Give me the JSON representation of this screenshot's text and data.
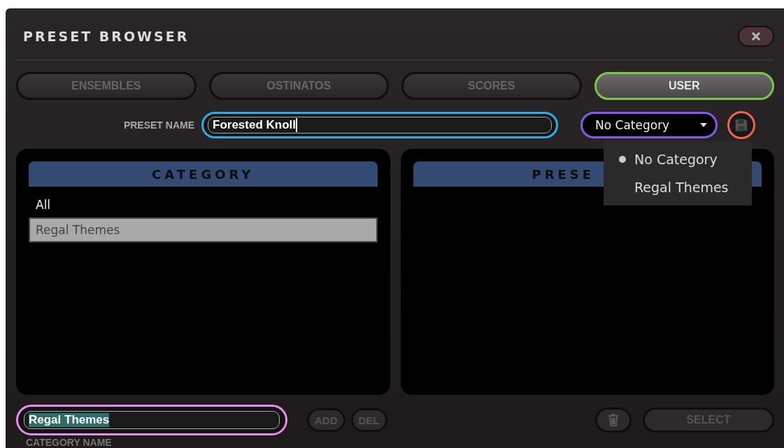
{
  "window": {
    "title": "PRESET BROWSER"
  },
  "tabs": [
    {
      "label": "ENSEMBLES",
      "selected": false
    },
    {
      "label": "OSTINATOS",
      "selected": false
    },
    {
      "label": "SCORES",
      "selected": false
    },
    {
      "label": "USER",
      "selected": true
    }
  ],
  "preset_name": {
    "label": "PRESET NAME",
    "value": "Forested Knoll"
  },
  "category_dropdown": {
    "value": "No Category",
    "expanded": true,
    "options": [
      {
        "label": "No Category",
        "selected": true
      },
      {
        "label": "Regal Themes",
        "selected": false
      }
    ]
  },
  "category_panel": {
    "header": "CATEGORY",
    "items": [
      {
        "label": "All",
        "selected": false
      },
      {
        "label": "Regal Themes",
        "selected": true
      }
    ]
  },
  "preset_panel": {
    "header": "PRESE"
  },
  "category_name": {
    "value": "Regal Themes",
    "label": "CATEGORY NAME"
  },
  "buttons": {
    "add": "ADD",
    "del": "DEL",
    "select": "SELECT"
  }
}
